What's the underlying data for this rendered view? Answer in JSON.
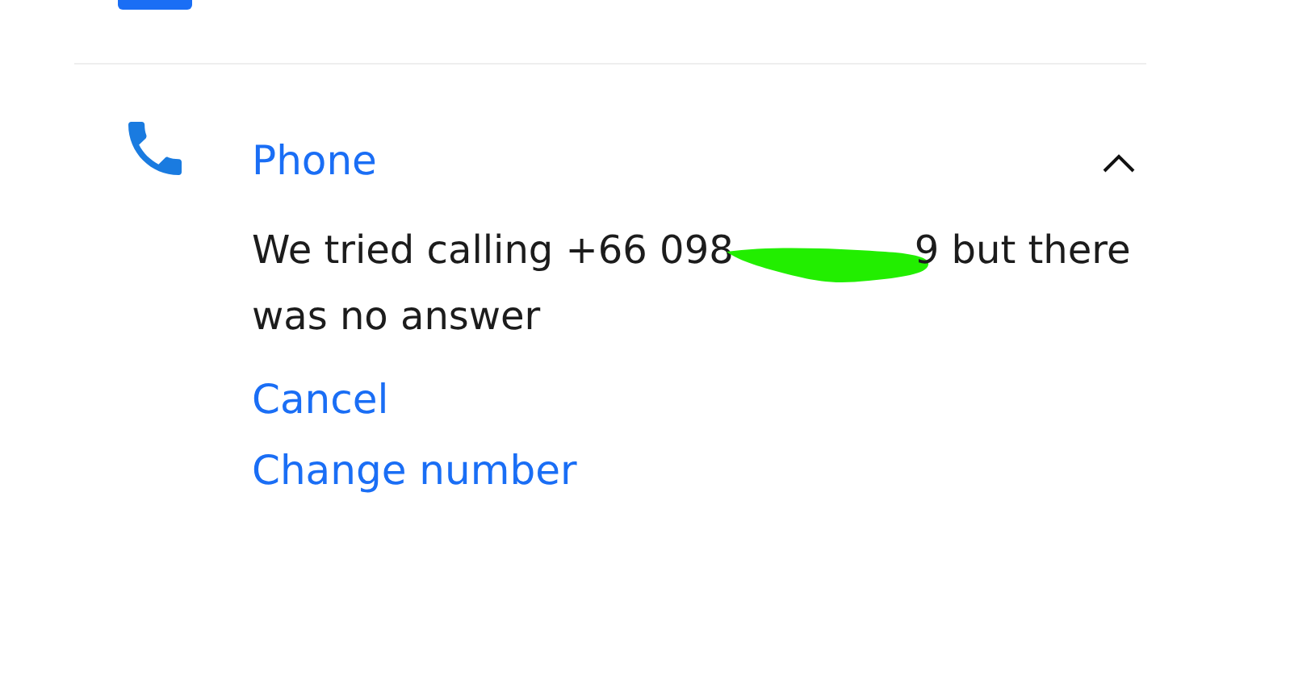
{
  "sections": [
    {
      "kind": "email"
    },
    {
      "kind": "phone",
      "label": "Phone",
      "expanded": true,
      "message_before": "We tried calling +66 098",
      "redacted": true,
      "message_after": "9 but there",
      "message_next_line": "was no answer",
      "actions": [
        "Cancel",
        "Change number"
      ]
    }
  ]
}
